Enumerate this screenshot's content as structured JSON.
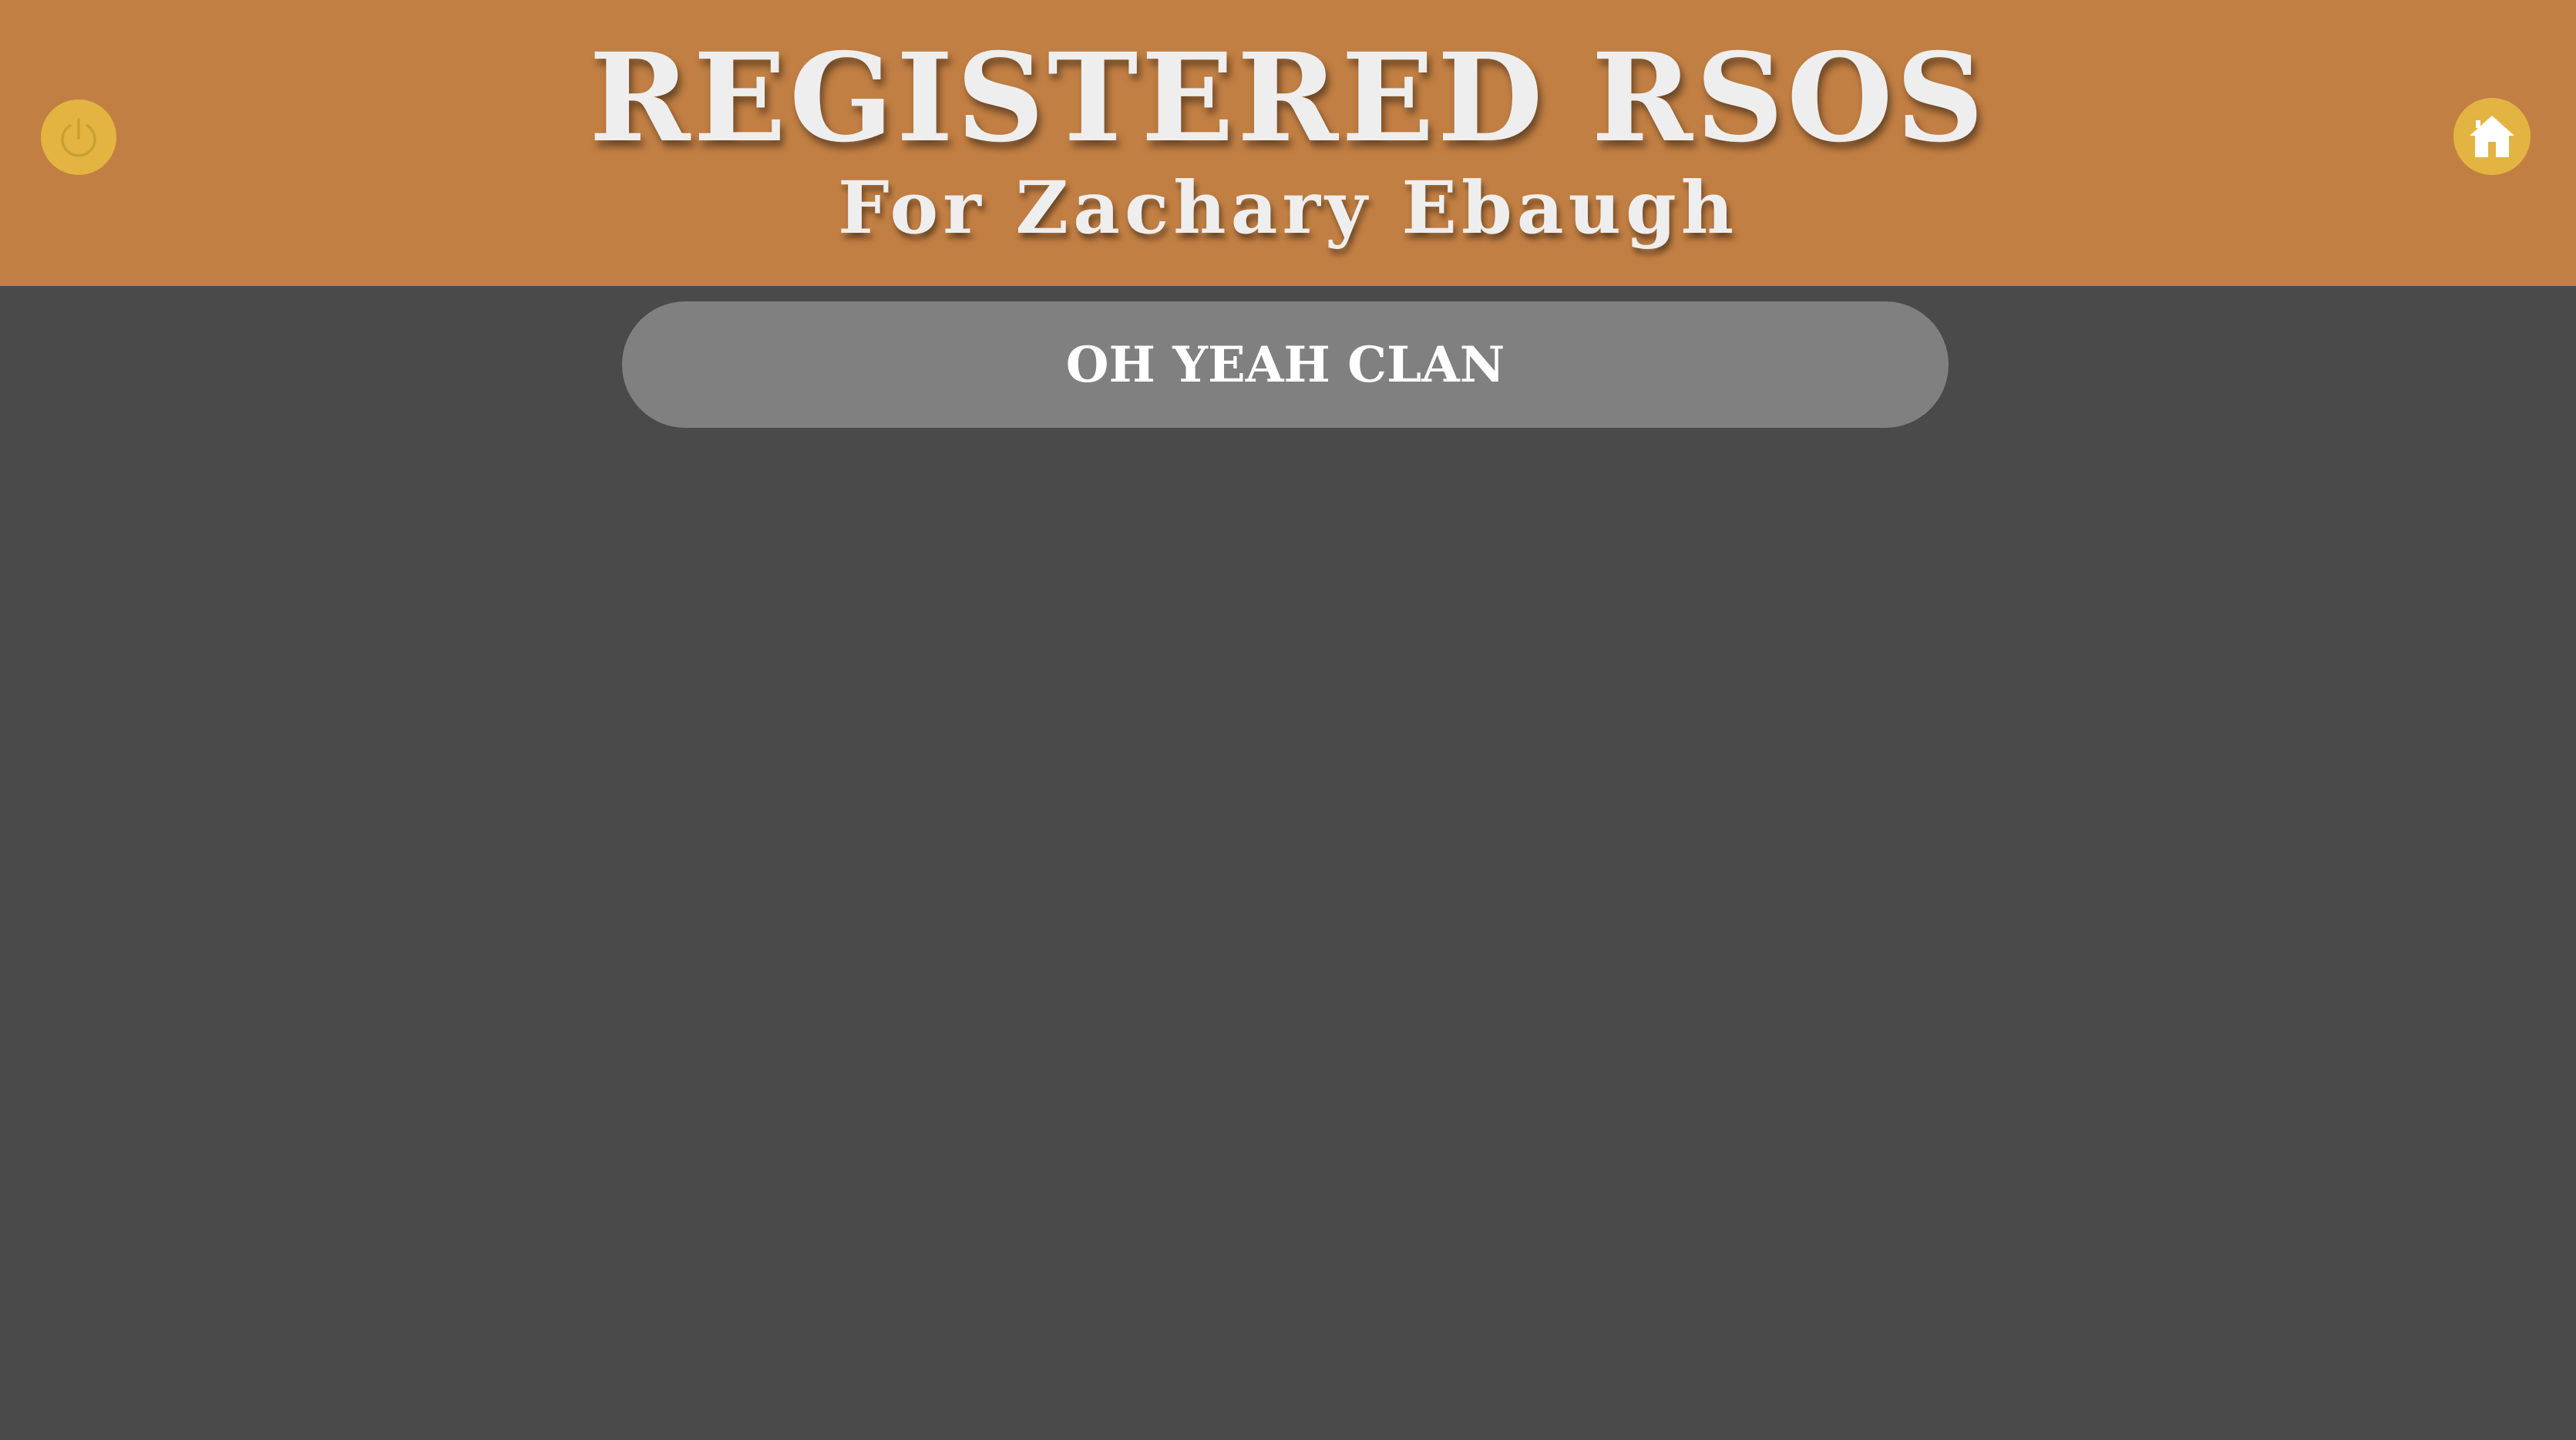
{
  "header": {
    "title": "REGISTERED RSOS",
    "subtitle": "For Zachary Ebaugh",
    "background_color": "#c27f43",
    "logout_icon": "power-icon",
    "home_icon": "home-icon",
    "icon_button_color": "#e3b441"
  },
  "main": {
    "background_color": "#4a4a4a",
    "rsos": [
      {
        "name": "OH YEAH CLAN"
      }
    ]
  }
}
